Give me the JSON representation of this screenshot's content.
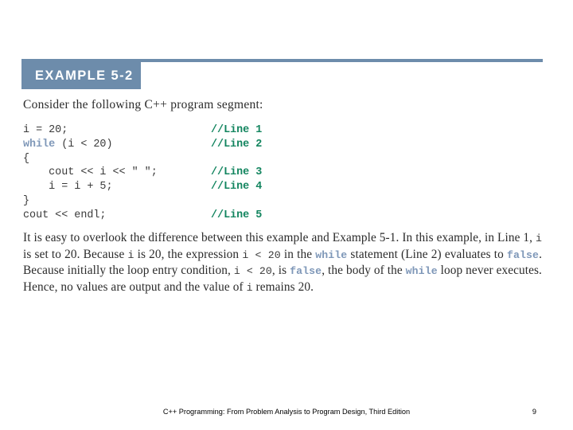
{
  "slide": {
    "accent_color": "#6d8cab",
    "comment_color": "#13855f",
    "keyword_color": "#7e97b8",
    "background_color": "#ffffff"
  },
  "header": {
    "tag_label": "EXAMPLE 5-2"
  },
  "intro": {
    "text": "Consider the following C++ program segment:"
  },
  "code": {
    "lines": [
      {
        "pre": "i = 20;",
        "keyword": "",
        "post": "",
        "comment": "//Line 1"
      },
      {
        "pre": "",
        "keyword": "while",
        "post": " (i < 20)",
        "comment": "//Line 2"
      },
      {
        "pre": "{",
        "keyword": "",
        "post": "",
        "comment": ""
      },
      {
        "pre": "    cout << i << \" \";",
        "keyword": "",
        "post": "",
        "comment": "//Line 3"
      },
      {
        "pre": "    i = i + 5;",
        "keyword": "",
        "post": "",
        "comment": "//Line 4"
      },
      {
        "pre": "}",
        "keyword": "",
        "post": "",
        "comment": ""
      },
      {
        "pre": "cout << endl;",
        "keyword": "",
        "post": "",
        "comment": "//Line 5"
      }
    ]
  },
  "paragraph": {
    "s1": "It is easy to overlook the difference between this example and Example 5-1. In this example, in Line 1, ",
    "c1": "i",
    "s2": " is set to 20. Because ",
    "c2": "i",
    "s3": " is 20, the expression ",
    "c3": "i < 20",
    "s4": " in the ",
    "k1": "while",
    "s5": " statement (Line 2) evaluates to ",
    "k2": "false",
    "s6": ". Because initially the loop entry condition, ",
    "c4": "i < 20",
    "s7": ", is ",
    "k3": "false",
    "s8": ", the body of the ",
    "k4": "while",
    "s9": " loop never executes. Hence, no values are output and the value of ",
    "c5": "i",
    "s10": " remains 20."
  },
  "footer": {
    "credit": "C++ Programming: From Problem Analysis to Program Design, Third Edition",
    "page_number": "9"
  }
}
